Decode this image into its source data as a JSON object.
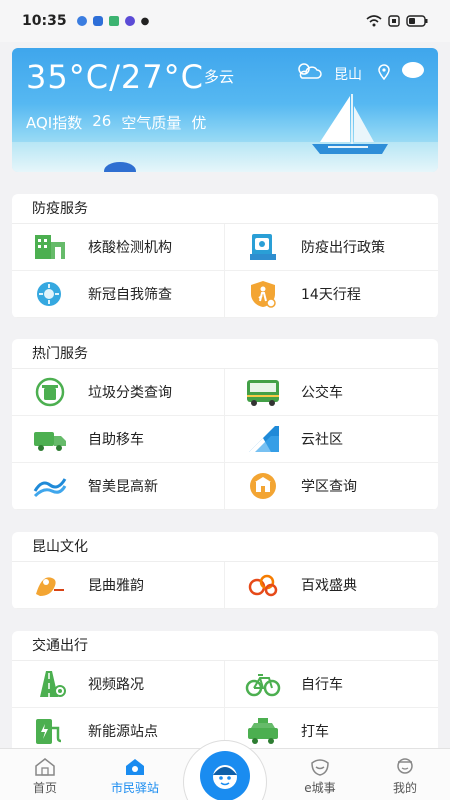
{
  "status": {
    "time": "10:35"
  },
  "weather": {
    "temp": "35°C/27°C",
    "condition": "多云",
    "city": "昆山",
    "aqi_label": "AQI指数",
    "aqi_value": "26",
    "quality_label": "空气质量",
    "quality_value": "优"
  },
  "sections": [
    {
      "title": "防疫服务",
      "items": [
        {
          "label": "核酸检测机构",
          "icon": "building-icon"
        },
        {
          "label": "防疫出行政策",
          "icon": "policy-doc-icon"
        },
        {
          "label": "新冠自我筛查",
          "icon": "virus-icon"
        },
        {
          "label": "14天行程",
          "icon": "travel-shield-icon"
        }
      ]
    },
    {
      "title": "热门服务",
      "items": [
        {
          "label": "垃圾分类查询",
          "icon": "recycle-bin-icon"
        },
        {
          "label": "公交车",
          "icon": "bus-icon"
        },
        {
          "label": "自助移车",
          "icon": "truck-icon"
        },
        {
          "label": "云社区",
          "icon": "cloud-community-icon"
        },
        {
          "label": "智美昆高新",
          "icon": "wave-logo-icon"
        },
        {
          "label": "学区查询",
          "icon": "school-icon"
        }
      ]
    },
    {
      "title": "昆山文化",
      "items": [
        {
          "label": "昆曲雅韵",
          "icon": "opera-icon"
        },
        {
          "label": "百戏盛典",
          "icon": "cloud-pattern-icon"
        }
      ]
    },
    {
      "title": "交通出行",
      "items": [
        {
          "label": "视频路况",
          "icon": "road-camera-icon"
        },
        {
          "label": "自行车",
          "icon": "bicycle-icon"
        },
        {
          "label": "新能源站点",
          "icon": "charging-icon"
        },
        {
          "label": "打车",
          "icon": "taxi-icon"
        }
      ]
    }
  ],
  "tabs": [
    {
      "label": "首页",
      "icon": "home-icon"
    },
    {
      "label": "市民驿站",
      "icon": "station-icon",
      "active": true
    },
    {
      "label": "e城事",
      "icon": "ecity-icon"
    },
    {
      "label": "我的",
      "icon": "profile-icon"
    }
  ],
  "colors": {
    "accent": "#1a8cf0",
    "sky": "#3fa6ec",
    "green": "#4caf50",
    "orange": "#f3a533"
  }
}
